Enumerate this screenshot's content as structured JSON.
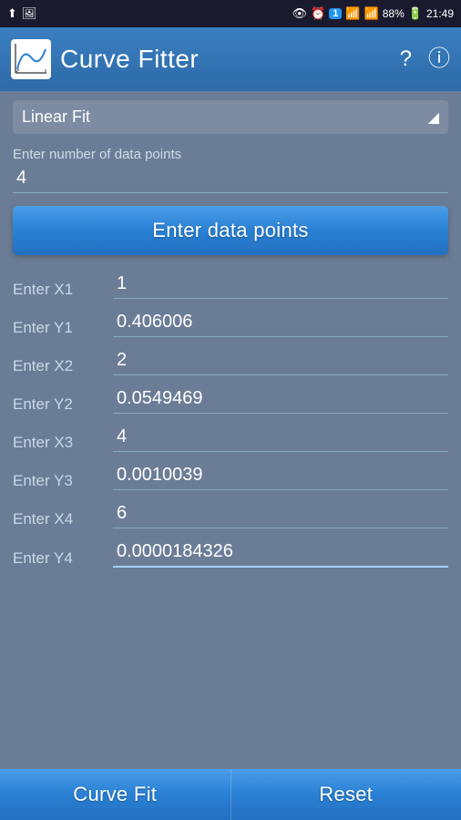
{
  "statusBar": {
    "icons_left": [
      "usb-icon",
      "image-icon"
    ],
    "icons_right": [
      "eye-icon",
      "alarm-icon",
      "notification-icon",
      "signal-bars-icon",
      "signal-strength-icon"
    ],
    "battery": "88%",
    "time": "21:49"
  },
  "appBar": {
    "title": "Curve Fitter",
    "helpBtn": "?",
    "infoBtn": "ⓘ"
  },
  "fitType": {
    "label": "Linear Fit"
  },
  "numPoints": {
    "label": "Enter number of data points",
    "value": "4"
  },
  "enterDataBtn": {
    "label": "Enter data points"
  },
  "fields": [
    {
      "label": "Enter X1",
      "value": "1"
    },
    {
      "label": "Enter Y1",
      "value": "0.406006"
    },
    {
      "label": "Enter X2",
      "value": "2"
    },
    {
      "label": "Enter Y2",
      "value": "0.0549469"
    },
    {
      "label": "Enter X3",
      "value": "4"
    },
    {
      "label": "Enter Y3",
      "value": "0.0010039"
    },
    {
      "label": "Enter X4",
      "value": "6"
    },
    {
      "label": "Enter Y4",
      "value": "0.0000184326"
    }
  ],
  "bottomBar": {
    "curveFit": "Curve Fit",
    "reset": "Reset"
  }
}
